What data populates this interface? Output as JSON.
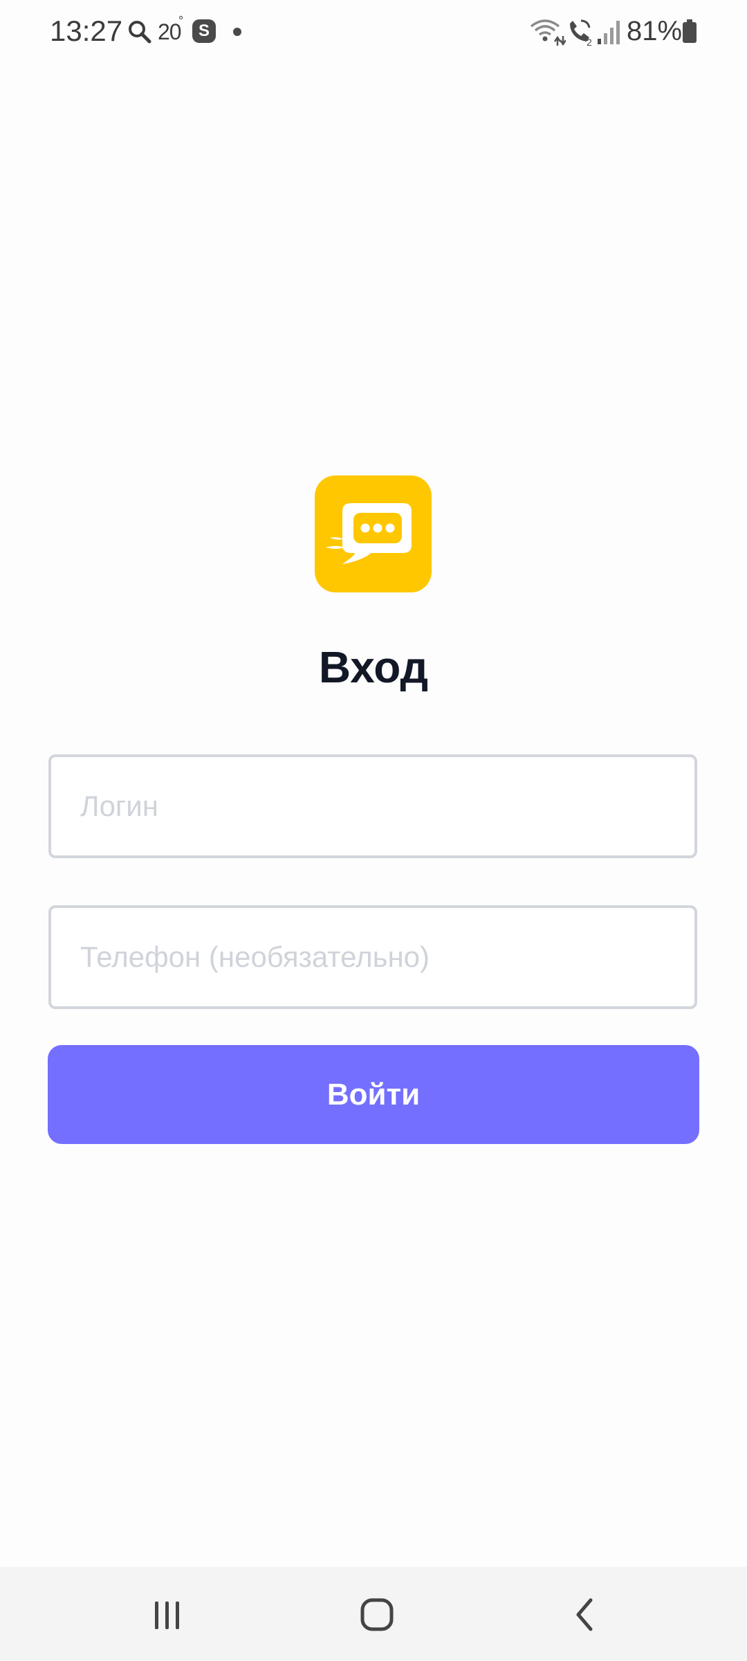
{
  "status_bar": {
    "time": "13:27",
    "temperature": "20",
    "temperature_unit": "°",
    "notification_app_letter": "S",
    "battery_percent": "81%",
    "icons": [
      "search-icon",
      "s-app-icon",
      "dot-icon",
      "wifi-icon",
      "wifi-call-icon",
      "signal-icon",
      "battery-icon"
    ]
  },
  "login": {
    "title": "Вход",
    "login_placeholder": "Логин",
    "login_value": "",
    "phone_placeholder": "Телефон (необязательно)",
    "phone_value": "",
    "submit_label": "Войти",
    "logo_icon": "chat-bubble-icon"
  },
  "nav_bar": {
    "buttons": [
      "recent-apps",
      "home",
      "back"
    ]
  },
  "colors": {
    "accent": "#746ffe",
    "logo_background": "#ffc700",
    "title": "#121826",
    "field_border": "#d2d6dc",
    "placeholder": "#cfd3da"
  }
}
